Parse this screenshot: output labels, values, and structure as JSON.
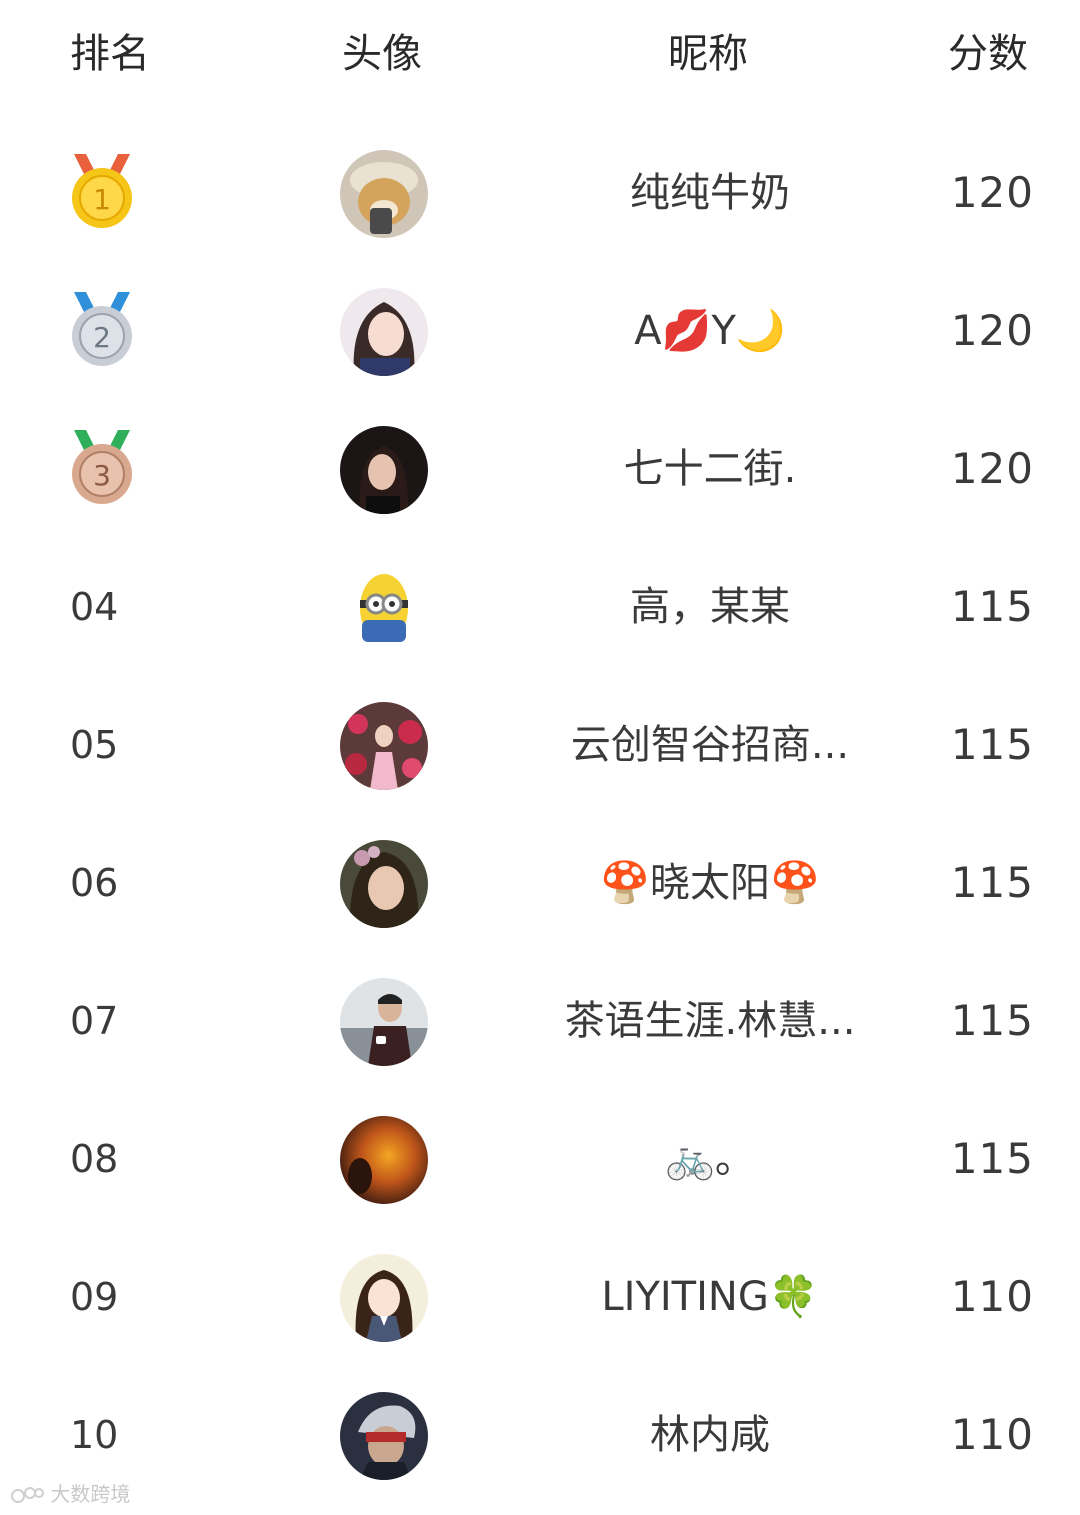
{
  "header": {
    "rank": "排名",
    "avatar": "头像",
    "nickname": "昵称",
    "score": "分数"
  },
  "rows": [
    {
      "rank": "1",
      "medal": "gold-medal-icon",
      "nickname": "纯纯牛奶",
      "score": "120"
    },
    {
      "rank": "2",
      "medal": "silver-medal-icon",
      "nickname": "A💋Y🌙",
      "score": "120"
    },
    {
      "rank": "3",
      "medal": "bronze-medal-icon",
      "nickname": "七十二街.",
      "score": "120"
    },
    {
      "rank": "04",
      "nickname": "高，某某",
      "score": "115"
    },
    {
      "rank": "05",
      "nickname": "云创智谷招商...",
      "score": "115"
    },
    {
      "rank": "06",
      "nickname": "🍄晓太阳🍄",
      "score": "115"
    },
    {
      "rank": "07",
      "nickname": "茶语生涯.林慧...",
      "score": "115"
    },
    {
      "rank": "08",
      "nickname": "🚲。",
      "score": "115"
    },
    {
      "rank": "09",
      "nickname": "LIYITING🍀",
      "score": "110"
    },
    {
      "rank": "10",
      "nickname": "林内咸",
      "score": "110"
    }
  ],
  "colors": {
    "gold": "#F5C518",
    "silver": "#C9CED6",
    "bronze": "#D9A98F",
    "ribbon_gold": "#E8603C",
    "ribbon_silver": "#2F8FD8",
    "ribbon_bronze": "#2FAF5A"
  },
  "watermark": "大数跨境"
}
